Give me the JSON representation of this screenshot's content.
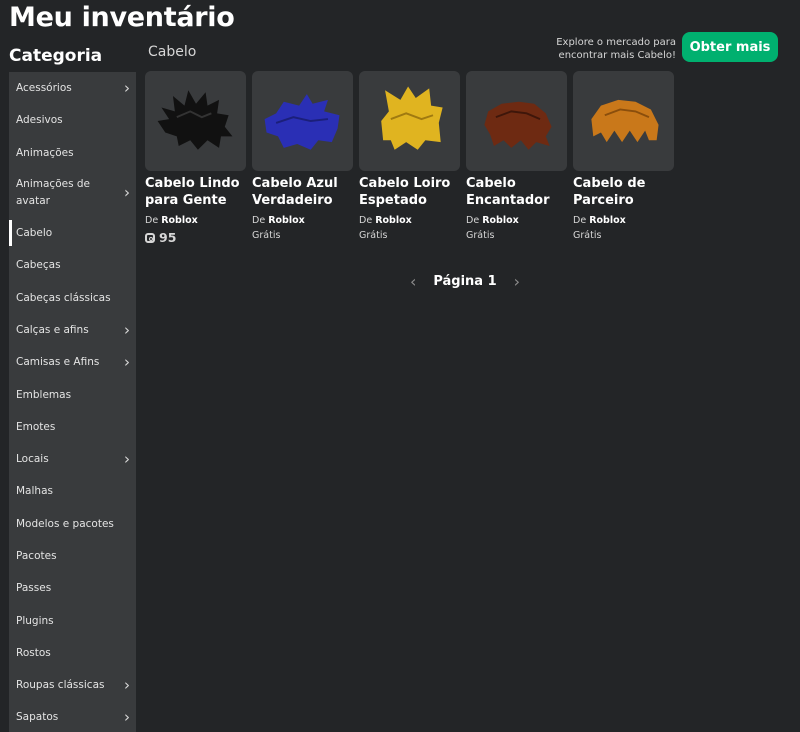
{
  "page": {
    "title": "Meu inventário",
    "category_heading": "Categoria",
    "section_title": "Cabelo",
    "explore_line1": "Explore o mercado para",
    "explore_line2": "encontrar mais Cabelo!",
    "get_more_label": "Obter mais"
  },
  "sidebar": {
    "items": [
      {
        "label": "Acessórios",
        "chevron": true
      },
      {
        "label": "Adesivos",
        "chevron": false
      },
      {
        "label": "Animações",
        "chevron": false
      },
      {
        "label": "Animações de avatar",
        "chevron": true
      },
      {
        "label": "Cabelo",
        "chevron": false,
        "active": true
      },
      {
        "label": "Cabeças",
        "chevron": false
      },
      {
        "label": "Cabeças clássicas",
        "chevron": false
      },
      {
        "label": "Calças e afins",
        "chevron": true
      },
      {
        "label": "Camisas e Afins",
        "chevron": true
      },
      {
        "label": "Emblemas",
        "chevron": false
      },
      {
        "label": "Emotes",
        "chevron": false
      },
      {
        "label": "Locais",
        "chevron": true
      },
      {
        "label": "Malhas",
        "chevron": false
      },
      {
        "label": "Modelos e pacotes",
        "chevron": false
      },
      {
        "label": "Pacotes",
        "chevron": false
      },
      {
        "label": "Passes",
        "chevron": false
      },
      {
        "label": "Plugins",
        "chevron": false
      },
      {
        "label": "Rostos",
        "chevron": false
      },
      {
        "label": "Roupas clássicas",
        "chevron": true
      },
      {
        "label": "Sapatos",
        "chevron": true
      }
    ],
    "chevron_glyph": "›"
  },
  "items": [
    {
      "name": "Cabelo Lindo para Gente",
      "creator_prefix": "De",
      "creator": "Roblox",
      "price": "95",
      "robux": true,
      "hair_color": "#111111",
      "hair_style": "spiky"
    },
    {
      "name": "Cabelo Azul Verdadeiro",
      "creator_prefix": "De",
      "creator": "Roblox",
      "price": "Grátis",
      "robux": false,
      "hair_color": "#2a2fb5",
      "hair_style": "swept"
    },
    {
      "name": "Cabelo Loiro Espetado",
      "creator_prefix": "De",
      "creator": "Roblox",
      "price": "Grátis",
      "robux": false,
      "hair_color": "#e0b420",
      "hair_style": "spiky-tall"
    },
    {
      "name": "Cabelo Encantador",
      "creator_prefix": "De",
      "creator": "Roblox",
      "price": "Grátis",
      "robux": false,
      "hair_color": "#6e2a12",
      "hair_style": "messy"
    },
    {
      "name": "Cabelo de Parceiro",
      "creator_prefix": "De",
      "creator": "Roblox",
      "price": "Grátis",
      "robux": false,
      "hair_color": "#c9781a",
      "hair_style": "bowl"
    }
  ],
  "pagination": {
    "label": "Página 1",
    "prev_glyph": "‹",
    "next_glyph": "›"
  }
}
